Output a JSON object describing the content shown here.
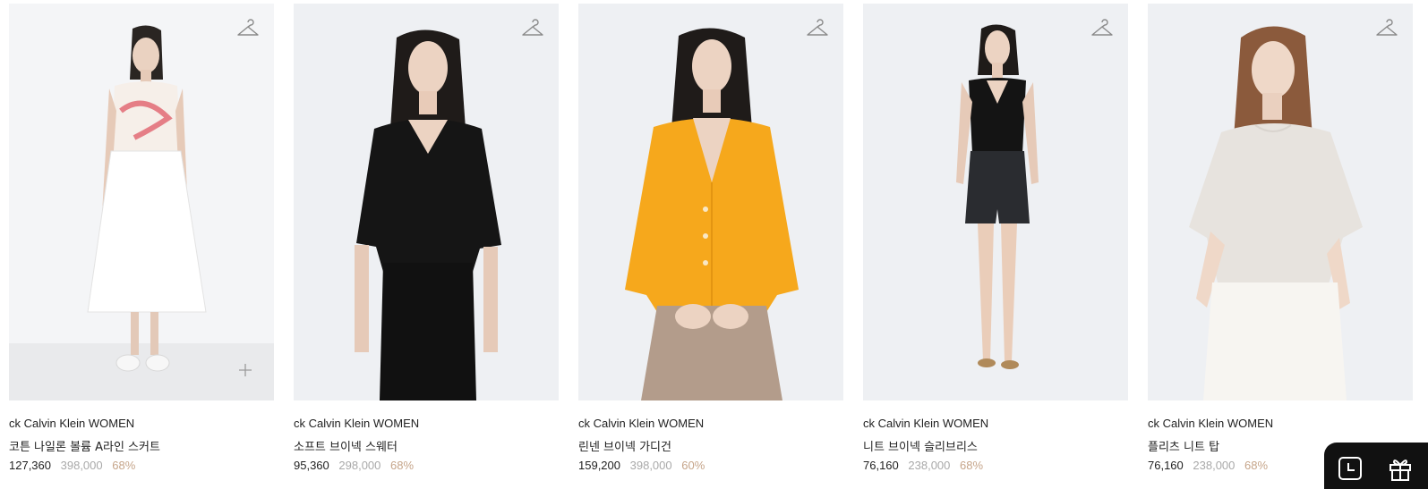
{
  "products": [
    {
      "brand": "ck Calvin Klein WOMEN",
      "name": "코튼 나일론 볼륨 A라인 스커트",
      "price": "127,360",
      "original_price": "398,000",
      "discount": "68%"
    },
    {
      "brand": "ck Calvin Klein WOMEN",
      "name": "소프트 브이넥 스웨터",
      "price": "95,360",
      "original_price": "298,000",
      "discount": "68%"
    },
    {
      "brand": "ck Calvin Klein WOMEN",
      "name": "린넨 브이넥 가디건",
      "price": "159,200",
      "original_price": "398,000",
      "discount": "60%"
    },
    {
      "brand": "ck Calvin Klein WOMEN",
      "name": "니트 브이넥 슬리브리스",
      "price": "76,160",
      "original_price": "238,000",
      "discount": "68%"
    },
    {
      "brand": "ck Calvin Klein WOMEN",
      "name": "플리츠 니트 탑",
      "price": "76,160",
      "original_price": "238,000",
      "discount": "68%"
    }
  ],
  "icons": {
    "wishlist": "hanger-icon",
    "quick_add": "plus-icon",
    "recent": "clock-icon",
    "gift": "gift-icon"
  },
  "colors": {
    "text": "#222222",
    "original_price": "#a9a9a9",
    "discount": "#c6a58a",
    "float_bar": "#111111"
  }
}
